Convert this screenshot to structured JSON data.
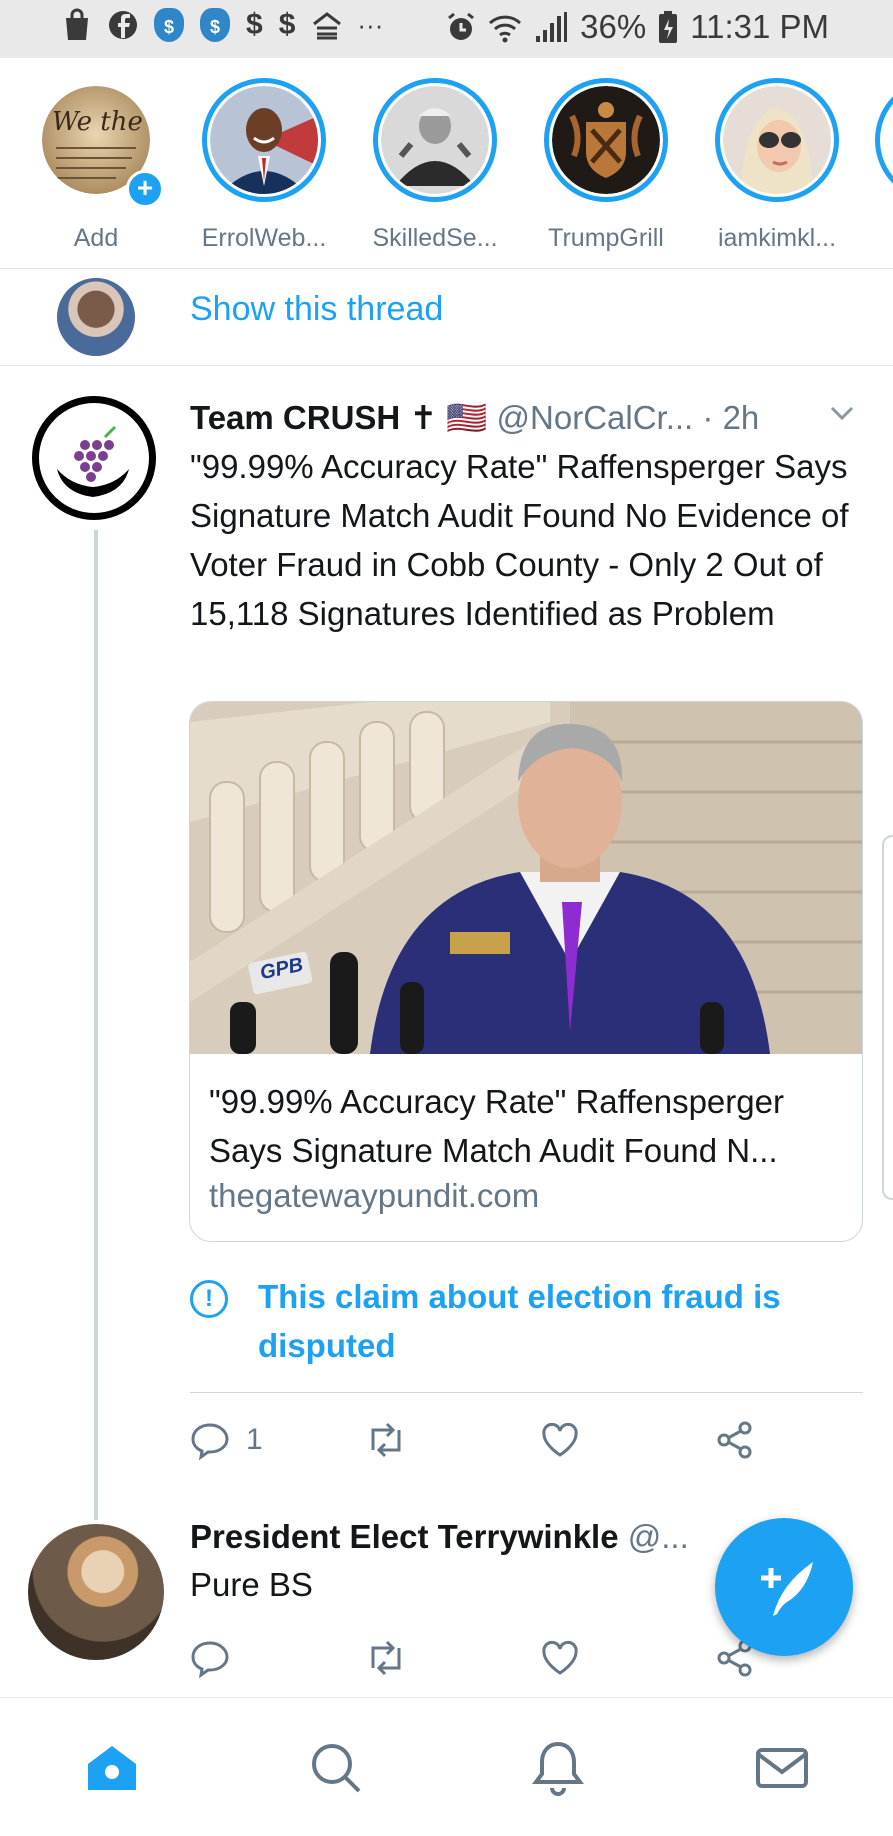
{
  "status_bar": {
    "battery": "36%",
    "time": "11:31 PM",
    "ellipsis": "···"
  },
  "stories": [
    {
      "label": "Add",
      "icon": "add-story-icon"
    },
    {
      "label": "ErrolWeb..."
    },
    {
      "label": "SkilledSe..."
    },
    {
      "label": "TrumpGrill"
    },
    {
      "label": "iamkimkl..."
    }
  ],
  "thread": {
    "show_label": "Show this thread"
  },
  "tweet": {
    "name": "Team CRUSH",
    "badge": "✝",
    "flag": "🇺🇸",
    "handle": "@NorCalCr...",
    "time": "· 2h",
    "text": "\"99.99% Accuracy Rate\" Raffensperger Says Signature Match Audit Found No Evidence of Voter Fraud in Cobb County - Only 2 Out of 15,118 Signatures Identified as Problem",
    "card": {
      "title": "\"99.99% Accuracy Rate\" Raffensperger Says Signature Match Audit Found N...",
      "url": "thegatewaypundit.com",
      "mic_label": "GPB"
    },
    "disputed_label": "This claim about election fraud is disputed",
    "reply_count": "1"
  },
  "tweet2": {
    "name": "President Elect Terrywinkle",
    "handle": "@...",
    "text": "Pure BS"
  },
  "colors": {
    "accent": "#1da1f2",
    "muted": "#657786",
    "border": "#ccd6dd"
  },
  "nav": [
    "home-icon",
    "search-icon",
    "notifications-icon",
    "messages-icon"
  ]
}
